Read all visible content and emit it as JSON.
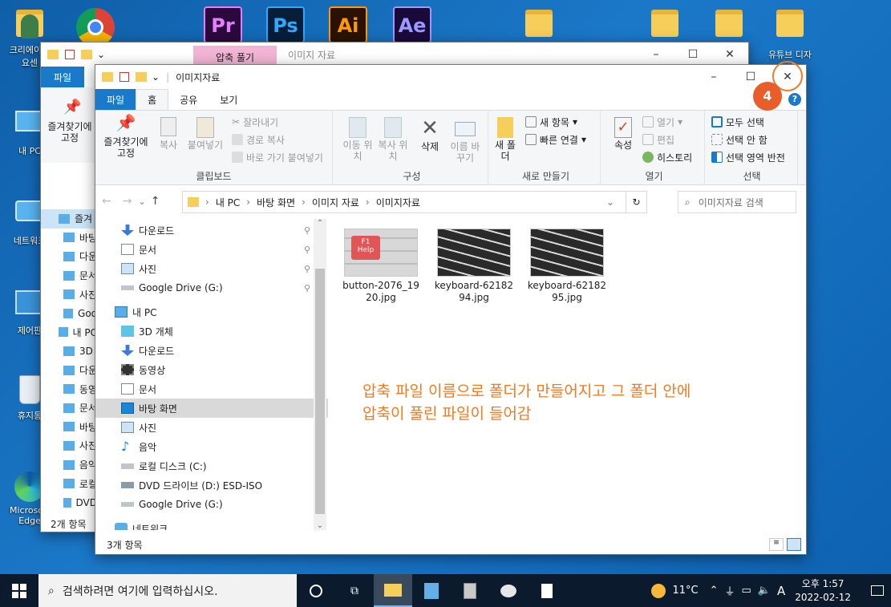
{
  "desktop": {
    "icons": [
      {
        "label": "크리에이션 요센",
        "type": "person"
      },
      {
        "label": "Chrome",
        "type": "chrome"
      },
      {
        "label": "내 PC",
        "type": "pc"
      },
      {
        "label": "네트워크",
        "type": "network"
      },
      {
        "label": "제어판",
        "type": "control"
      },
      {
        "label": "휴지통",
        "type": "trash"
      },
      {
        "label": "Microsoft Edge",
        "type": "edge"
      },
      {
        "label": "유튜브 디자인",
        "type": "folder"
      }
    ],
    "adobe": [
      {
        "label": "Pr",
        "bg": "#2a0a3d",
        "fg": "#e77cff"
      },
      {
        "label": "Ps",
        "bg": "#061e3a",
        "fg": "#31a8ff"
      },
      {
        "label": "Ai",
        "bg": "#2b1200",
        "fg": "#ff9a00"
      },
      {
        "label": "Ae",
        "bg": "#1a0a3a",
        "fg": "#9a9aff"
      }
    ]
  },
  "back_window": {
    "context_tab": "압축 풀기",
    "title": "이미지 자료",
    "tab_file": "파일",
    "pin_label": "즐겨찾기에 고정",
    "status": "2개 항목",
    "sidebar": [
      "즐겨",
      "바탕",
      "다운",
      "문서",
      "사진",
      "Goo",
      "내 PC",
      "3D",
      "다운",
      "동영",
      "문서",
      "바탕",
      "사진",
      "음악",
      "로컬",
      "DVD"
    ]
  },
  "window": {
    "title": "이미지자료",
    "ribbon_tabs": {
      "file": "파일",
      "home": "홈",
      "share": "공유",
      "view": "보기"
    },
    "clipboard": {
      "pin": "즐겨찾기에 고정",
      "copy": "복사",
      "paste": "붙여넣기",
      "cut": "잘라내기",
      "copy_path": "경로 복사",
      "paste_shortcut": "바로 가기 붙여넣기",
      "label": "클립보드"
    },
    "organize": {
      "move": "이동 위치",
      "copy_to": "복사 위치",
      "delete": "삭제",
      "rename": "이름 바꾸기",
      "label": "구성"
    },
    "new": {
      "folder": "새 폴더",
      "new_item": "새 항목",
      "easy_access": "빠른 연결",
      "label": "새로 만들기"
    },
    "open": {
      "properties": "속성",
      "open": "열기",
      "edit": "편집",
      "history": "히스토리",
      "label": "열기"
    },
    "select": {
      "all": "모두 선택",
      "none": "선택 안 함",
      "invert": "선택 영역 반전",
      "label": "선택"
    },
    "breadcrumb": [
      "내 PC",
      "바탕 화면",
      "이미지 자료",
      "이미지자료"
    ],
    "search_placeholder": "이미지자료 검색",
    "nav_tree": [
      {
        "label": "다운로드",
        "icon": "download-icon",
        "indent": 1,
        "pinned": true
      },
      {
        "label": "문서",
        "icon": "document-icon",
        "indent": 1,
        "pinned": true
      },
      {
        "label": "사진",
        "icon": "picture-icon",
        "indent": 1,
        "pinned": true
      },
      {
        "label": "Google Drive (G:)",
        "icon": "drive-icon",
        "indent": 1,
        "pinned": true
      },
      {
        "label": "내 PC",
        "icon": "pc-icon",
        "indent": 0,
        "pinned": false
      },
      {
        "label": "3D 개체",
        "icon": "cube-icon",
        "indent": 1,
        "pinned": false
      },
      {
        "label": "다운로드",
        "icon": "download-icon",
        "indent": 1,
        "pinned": false
      },
      {
        "label": "동영상",
        "icon": "video-icon",
        "indent": 1,
        "pinned": false
      },
      {
        "label": "문서",
        "icon": "document-icon",
        "indent": 1,
        "pinned": false
      },
      {
        "label": "바탕 화면",
        "icon": "desktop-icon",
        "indent": 1,
        "pinned": false,
        "selected": true
      },
      {
        "label": "사진",
        "icon": "picture-icon",
        "indent": 1,
        "pinned": false
      },
      {
        "label": "음악",
        "icon": "music-icon",
        "indent": 1,
        "pinned": false
      },
      {
        "label": "로컬 디스크 (C:)",
        "icon": "disk-icon",
        "indent": 1,
        "pinned": false
      },
      {
        "label": "DVD 드라이브 (D:) ESD-ISO",
        "icon": "dvd-icon",
        "indent": 1,
        "pinned": false
      },
      {
        "label": "Google Drive (G:)",
        "icon": "drive-icon",
        "indent": 1,
        "pinned": false
      },
      {
        "label": "네트워크",
        "icon": "network-icon",
        "indent": 0,
        "pinned": false
      }
    ],
    "files": [
      {
        "name": "button-2076_1920.jpg",
        "thumb": "keyboard-red"
      },
      {
        "name": "keyboard-6218294.jpg",
        "thumb": "keyboard-dark"
      },
      {
        "name": "keyboard-6218295.jpg",
        "thumb": "keyboard-dark"
      }
    ],
    "status": "3개 항목"
  },
  "annotation": {
    "line1": "압축 파일 이름으로 폴더가 만들어지고 그 폴더 안에",
    "line2": "압축이 풀린 파일이 들어감",
    "step": "4",
    "color": "#f07b22"
  },
  "taskbar": {
    "search_placeholder": "검색하려면 여기에 입력하십시오.",
    "weather": "11°C",
    "ime": "A",
    "time": "오후 1:57",
    "date": "2022-02-12"
  }
}
